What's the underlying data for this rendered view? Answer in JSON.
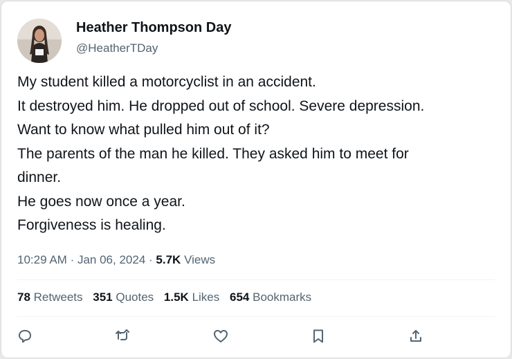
{
  "author": {
    "name": "Heather Thompson Day",
    "handle": "@HeatherTDay"
  },
  "tweet": {
    "lines": [
      "My student killed a motorcyclist in an accident.",
      "It destroyed him. He dropped out of school. Severe depression.",
      "Want to know what pulled him out of it?",
      "The parents of the man he killed. They asked him to meet for",
      "dinner.",
      "He goes now once a year.",
      "Forgiveness is healing."
    ],
    "time": "10:29 AM",
    "date": "Jan 06, 2024",
    "separator": "·",
    "views_count": "5.7K",
    "views_label": "Views"
  },
  "stats": {
    "retweets_count": "78",
    "retweets_label": "Retweets",
    "quotes_count": "351",
    "quotes_label": "Quotes",
    "likes_count": "1.5K",
    "likes_label": "Likes",
    "bookmarks_count": "654",
    "bookmarks_label": "Bookmarks"
  },
  "actions": [
    "reply-icon",
    "retweet-icon",
    "like-icon",
    "bookmark-icon",
    "share-icon"
  ],
  "colors": {
    "text": "#0f1419",
    "secondary": "#536471",
    "divider": "#eff3f4"
  }
}
